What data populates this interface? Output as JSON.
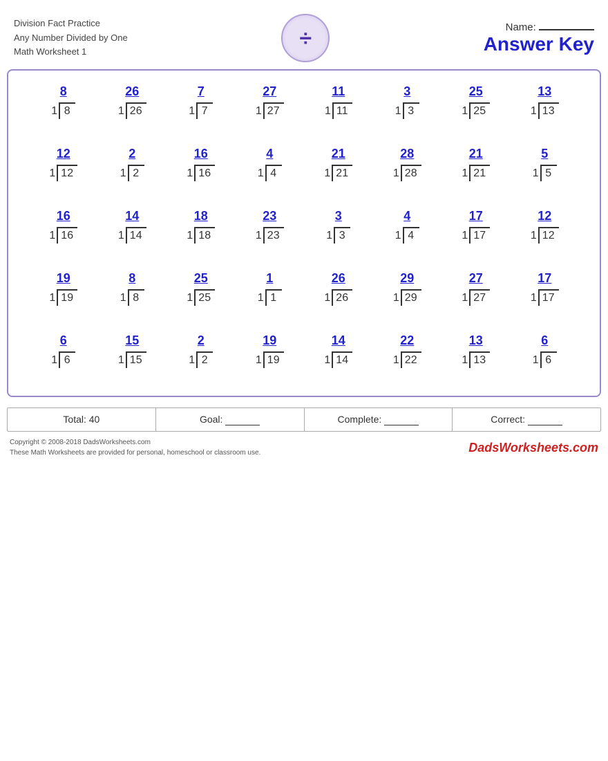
{
  "header": {
    "line1": "Division Fact Practice",
    "line2": "Any Number Divided by One",
    "line3": "Math Worksheet 1",
    "name_label": "Name:",
    "answer_key": "Answer Key",
    "division_symbol": "÷"
  },
  "rows": [
    [
      {
        "answer": "8",
        "divisor": "1",
        "dividend": "8"
      },
      {
        "answer": "26",
        "divisor": "1",
        "dividend": "26"
      },
      {
        "answer": "7",
        "divisor": "1",
        "dividend": "7"
      },
      {
        "answer": "27",
        "divisor": "1",
        "dividend": "27"
      },
      {
        "answer": "11",
        "divisor": "1",
        "dividend": "11"
      },
      {
        "answer": "3",
        "divisor": "1",
        "dividend": "3"
      },
      {
        "answer": "25",
        "divisor": "1",
        "dividend": "25"
      },
      {
        "answer": "13",
        "divisor": "1",
        "dividend": "13"
      }
    ],
    [
      {
        "answer": "12",
        "divisor": "1",
        "dividend": "12"
      },
      {
        "answer": "2",
        "divisor": "1",
        "dividend": "2"
      },
      {
        "answer": "16",
        "divisor": "1",
        "dividend": "16"
      },
      {
        "answer": "4",
        "divisor": "1",
        "dividend": "4"
      },
      {
        "answer": "21",
        "divisor": "1",
        "dividend": "21"
      },
      {
        "answer": "28",
        "divisor": "1",
        "dividend": "28"
      },
      {
        "answer": "21",
        "divisor": "1",
        "dividend": "21"
      },
      {
        "answer": "5",
        "divisor": "1",
        "dividend": "5"
      }
    ],
    [
      {
        "answer": "16",
        "divisor": "1",
        "dividend": "16"
      },
      {
        "answer": "14",
        "divisor": "1",
        "dividend": "14"
      },
      {
        "answer": "18",
        "divisor": "1",
        "dividend": "18"
      },
      {
        "answer": "23",
        "divisor": "1",
        "dividend": "23"
      },
      {
        "answer": "3",
        "divisor": "1",
        "dividend": "3"
      },
      {
        "answer": "4",
        "divisor": "1",
        "dividend": "4"
      },
      {
        "answer": "17",
        "divisor": "1",
        "dividend": "17"
      },
      {
        "answer": "12",
        "divisor": "1",
        "dividend": "12"
      }
    ],
    [
      {
        "answer": "19",
        "divisor": "1",
        "dividend": "19"
      },
      {
        "answer": "8",
        "divisor": "1",
        "dividend": "8"
      },
      {
        "answer": "25",
        "divisor": "1",
        "dividend": "25"
      },
      {
        "answer": "1",
        "divisor": "1",
        "dividend": "1"
      },
      {
        "answer": "26",
        "divisor": "1",
        "dividend": "26"
      },
      {
        "answer": "29",
        "divisor": "1",
        "dividend": "29"
      },
      {
        "answer": "27",
        "divisor": "1",
        "dividend": "27"
      },
      {
        "answer": "17",
        "divisor": "1",
        "dividend": "17"
      }
    ],
    [
      {
        "answer": "6",
        "divisor": "1",
        "dividend": "6"
      },
      {
        "answer": "15",
        "divisor": "1",
        "dividend": "15"
      },
      {
        "answer": "2",
        "divisor": "1",
        "dividend": "2"
      },
      {
        "answer": "19",
        "divisor": "1",
        "dividend": "19"
      },
      {
        "answer": "14",
        "divisor": "1",
        "dividend": "14"
      },
      {
        "answer": "22",
        "divisor": "1",
        "dividend": "22"
      },
      {
        "answer": "13",
        "divisor": "1",
        "dividend": "13"
      },
      {
        "answer": "6",
        "divisor": "1",
        "dividend": "6"
      }
    ]
  ],
  "footer": {
    "total_label": "Total:",
    "total_value": "40",
    "goal_label": "Goal:",
    "complete_label": "Complete:",
    "correct_label": "Correct:"
  },
  "copyright": {
    "line1": "Copyright © 2008-2018 DadsWorksheets.com",
    "line2": "These Math Worksheets are provided for personal, homeschool or classroom use.",
    "logo": "DadsWorksheets.com"
  }
}
